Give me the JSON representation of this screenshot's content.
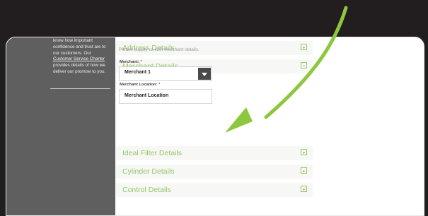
{
  "sidebar": {
    "text_before_link": "know how important confidence and trust are to our customers. Our",
    "link_text": "Customer Service Charter",
    "text_after_link": "provides details of how we deliver our promise to you."
  },
  "accordions": {
    "address": "Address Details",
    "merchant": "Merchant Details",
    "ideal_filter": "Ideal Filter Details",
    "cylinder": "Cylinder Details",
    "control": "Control Details"
  },
  "merchant": {
    "helper": "Please supply us with merchant details.",
    "merchant_label": "Merchant:",
    "merchant_selected": "Merchant 1",
    "location_label": "Merchant Location:",
    "location_value": "Merchant Location",
    "required_mark": "*"
  },
  "colors": {
    "accent_green": "#8dc63f",
    "sidebar_gray": "#5f5f5f",
    "background_dark": "#221d1e"
  },
  "icons": {
    "accordion_toggle": "plus-box-icon",
    "select_arrow": "chevron-down-icon",
    "annotation": "green-arrow-icon"
  }
}
